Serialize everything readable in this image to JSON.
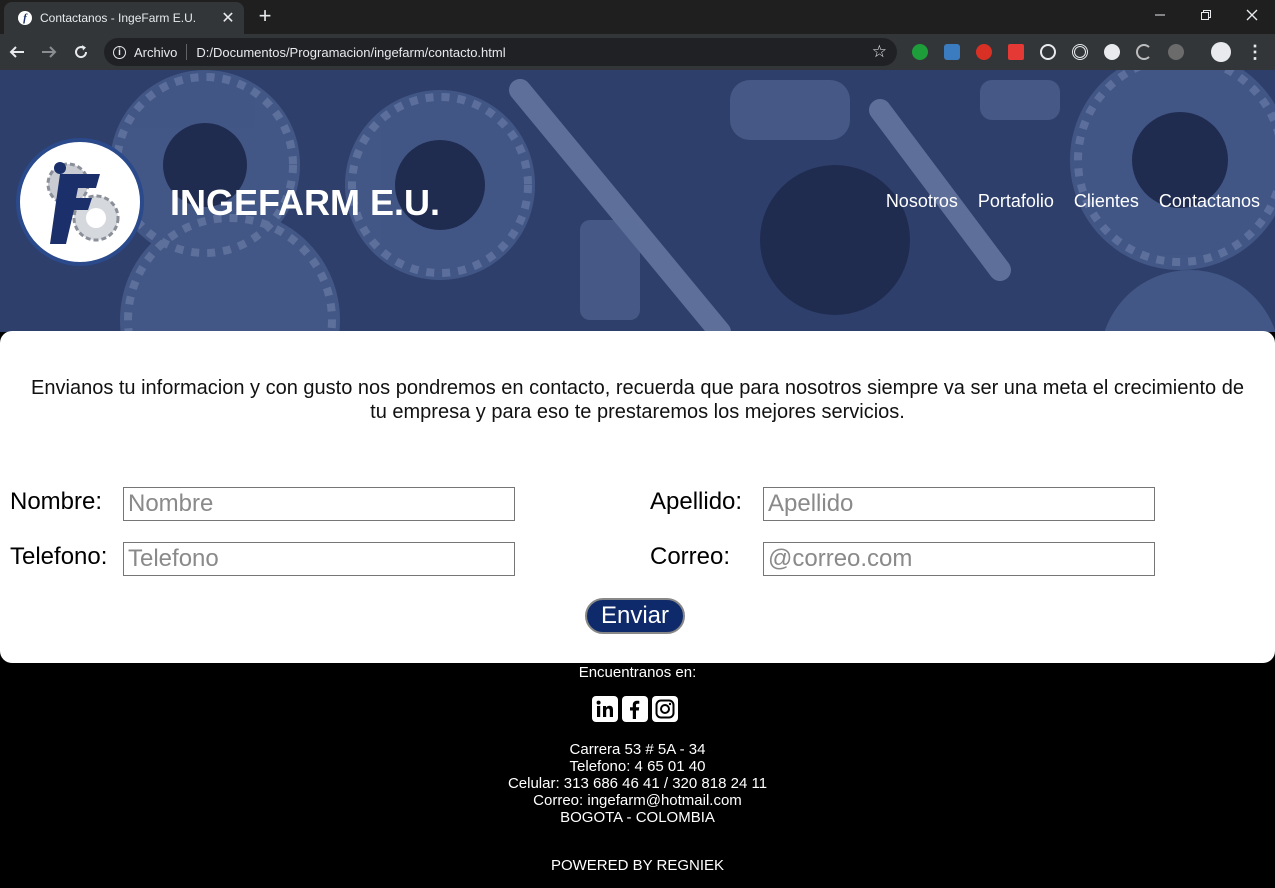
{
  "browser": {
    "tab_title": "Contactanos - IngeFarm E.U.",
    "tab_close": "✕",
    "new_tab": "+",
    "security_label": "Archivo",
    "url": "D:/Documentos/Programacion/ingefarm/contacto.html",
    "star": "☆",
    "menu": "⋮"
  },
  "header": {
    "brand": "INGEFARM E.U.",
    "nav": [
      "Nosotros",
      "Portafolio",
      "Clientes",
      "Contactanos"
    ]
  },
  "form": {
    "intro": "Envianos tu informacion y con gusto nos pondremos en contacto, recuerda que para nosotros siempre va ser una meta el crecimiento de tu empresa y para eso te prestaremos los mejores servicios.",
    "nombre_label": "Nombre:",
    "nombre_placeholder": "Nombre",
    "apellido_label": "Apellido:",
    "apellido_placeholder": "Apellido",
    "telefono_label": "Telefono:",
    "telefono_placeholder": "Telefono",
    "correo_label": "Correo:",
    "correo_placeholder": "@correo.com",
    "submit": "Enviar"
  },
  "footer": {
    "heading": "Encuentranos en:",
    "social_icons": [
      "linkedin-icon",
      "facebook-icon",
      "instagram-icon"
    ],
    "address": "Carrera 53 # 5A - 34",
    "phone": "Telefono: 4 65 01 40",
    "cell": "Celular: 313 686 46 41 / 320 818 24 11",
    "email": "Correo: ingefarm@hotmail.com",
    "city": "BOGOTA - COLOMBIA",
    "powered": "POWERED BY REGNIEK"
  },
  "colors": {
    "header_overlay": "#2b3c68",
    "button": "#0f2a6b",
    "footer_bg": "#000000"
  }
}
